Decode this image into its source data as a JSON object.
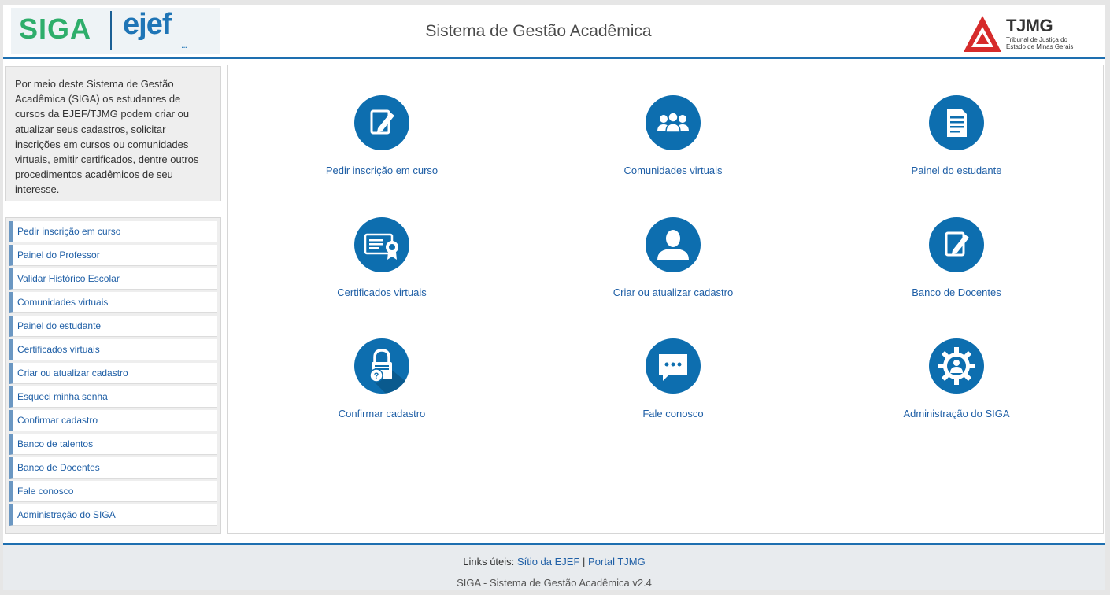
{
  "header": {
    "logo_siga": "SIGA",
    "logo_ejef": "ejef",
    "logo_dots": "...",
    "title": "Sistema de Gestão Acadêmica",
    "tjmg_name": "TJMG",
    "tjmg_sub_1": "Tribunal de Justiça do",
    "tjmg_sub_2": "Estado de Minas Gerais"
  },
  "sidebar": {
    "intro": "Por meio deste Sistema de Gestão Acadêmica (SIGA) os estudantes de cursos da EJEF/TJMG podem criar ou atualizar seus cadastros, solicitar inscrições em cursos ou comunidades virtuais, emitir certificados, dentre outros procedimentos acadêmicos de seu interesse.",
    "items": [
      {
        "label": "Pedir inscrição em curso"
      },
      {
        "label": "Painel do Professor"
      },
      {
        "label": "Validar Histórico Escolar"
      },
      {
        "label": "Comunidades virtuais"
      },
      {
        "label": "Painel do estudante"
      },
      {
        "label": "Certificados virtuais"
      },
      {
        "label": "Criar ou atualizar cadastro"
      },
      {
        "label": "Esqueci minha senha"
      },
      {
        "label": "Confirmar cadastro"
      },
      {
        "label": "Banco de talentos"
      },
      {
        "label": "Banco de Docentes"
      },
      {
        "label": "Fale conosco"
      },
      {
        "label": "Administração do SIGA"
      }
    ]
  },
  "tiles": [
    {
      "label": "Pedir inscrição em curso",
      "icon": "edit-icon"
    },
    {
      "label": "Comunidades virtuais",
      "icon": "group-icon"
    },
    {
      "label": "Painel do estudante",
      "icon": "document-icon"
    },
    {
      "label": "Certificados virtuais",
      "icon": "certificate-icon"
    },
    {
      "label": "Criar ou atualizar cadastro",
      "icon": "user-icon"
    },
    {
      "label": "Banco de Docentes",
      "icon": "edit-icon"
    },
    {
      "label": "Confirmar cadastro",
      "icon": "lock-question-icon"
    },
    {
      "label": "Fale conosco",
      "icon": "chat-icon"
    },
    {
      "label": "Administração do SIGA",
      "icon": "gear-user-icon"
    }
  ],
  "footer": {
    "links_label": "Links úteis:",
    "link_ejef": "Sítio da EJEF",
    "separator": "|",
    "link_tjmg": "Portal TJMG",
    "version": "SIGA - Sistema de Gestão Acadêmica v2.4"
  },
  "colors": {
    "accent": "#1e6fb0",
    "icon_bg": "#0d6eaf",
    "link": "#1f5fa6",
    "siga_green": "#2eae6b",
    "tjmg_red": "#d62b2b"
  }
}
